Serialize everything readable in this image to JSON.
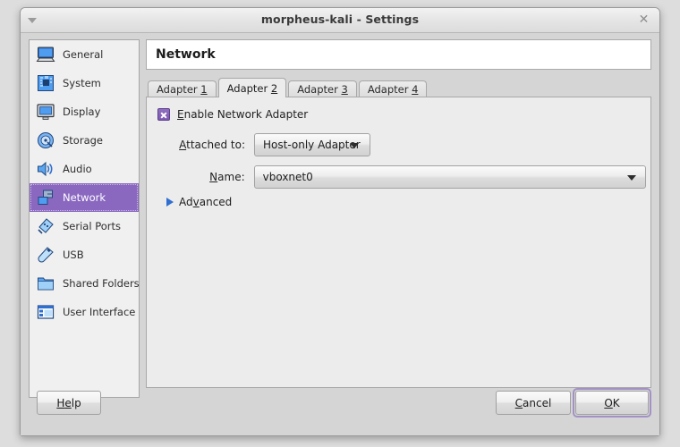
{
  "window": {
    "title": "morpheus-kali - Settings",
    "menu_icon": "chevron-down-icon",
    "close_icon": "close-icon"
  },
  "sidebar": {
    "items": [
      {
        "label": "General",
        "icon": "monitor-icon",
        "selected": false
      },
      {
        "label": "System",
        "icon": "motherboard-icon",
        "selected": false
      },
      {
        "label": "Display",
        "icon": "display-icon",
        "selected": false
      },
      {
        "label": "Storage",
        "icon": "harddisk-icon",
        "selected": false
      },
      {
        "label": "Audio",
        "icon": "speaker-icon",
        "selected": false
      },
      {
        "label": "Network",
        "icon": "network-icon",
        "selected": true
      },
      {
        "label": "Serial Ports",
        "icon": "serial-plug-icon",
        "selected": false
      },
      {
        "label": "USB",
        "icon": "usb-icon",
        "selected": false
      },
      {
        "label": "Shared Folders",
        "icon": "folder-icon",
        "selected": false
      },
      {
        "label": "User Interface",
        "icon": "window-panel-icon",
        "selected": false
      }
    ]
  },
  "page": {
    "title": "Network"
  },
  "tabs": [
    {
      "label": "Adapter 1",
      "mnemonic": "1",
      "active": false
    },
    {
      "label": "Adapter 2",
      "mnemonic": "2",
      "active": true
    },
    {
      "label": "Adapter 3",
      "mnemonic": "3",
      "active": false
    },
    {
      "label": "Adapter 4",
      "mnemonic": "4",
      "active": false
    }
  ],
  "form": {
    "enable_checkbox": {
      "label_pre": "E",
      "label_post": "nable Network Adapter",
      "checked": true
    },
    "attached_to": {
      "label_pre": "A",
      "label_post": "ttached to:",
      "value": "Host-only Adapter"
    },
    "name": {
      "label_pre": "N",
      "label_post": "ame:",
      "value": "vboxnet0"
    },
    "advanced": {
      "label_pre": "Ad",
      "label_mn": "v",
      "label_post": "anced",
      "expanded": false
    }
  },
  "footer": {
    "help": {
      "pre": "H",
      "mn": "e",
      "post": "lp"
    },
    "cancel": {
      "pre": "",
      "mn": "C",
      "post": "ancel"
    },
    "ok": {
      "pre": "",
      "mn": "O",
      "post": "K",
      "focused": true
    }
  },
  "colors": {
    "accent_purple": "#8a68c0",
    "checkbox_purple": "#7d59b1",
    "focus_ring": "#a391c6",
    "advanced_blue": "#2f6fd0",
    "window_bg": "#d5d5d5",
    "pane_bg": "#ececec"
  }
}
